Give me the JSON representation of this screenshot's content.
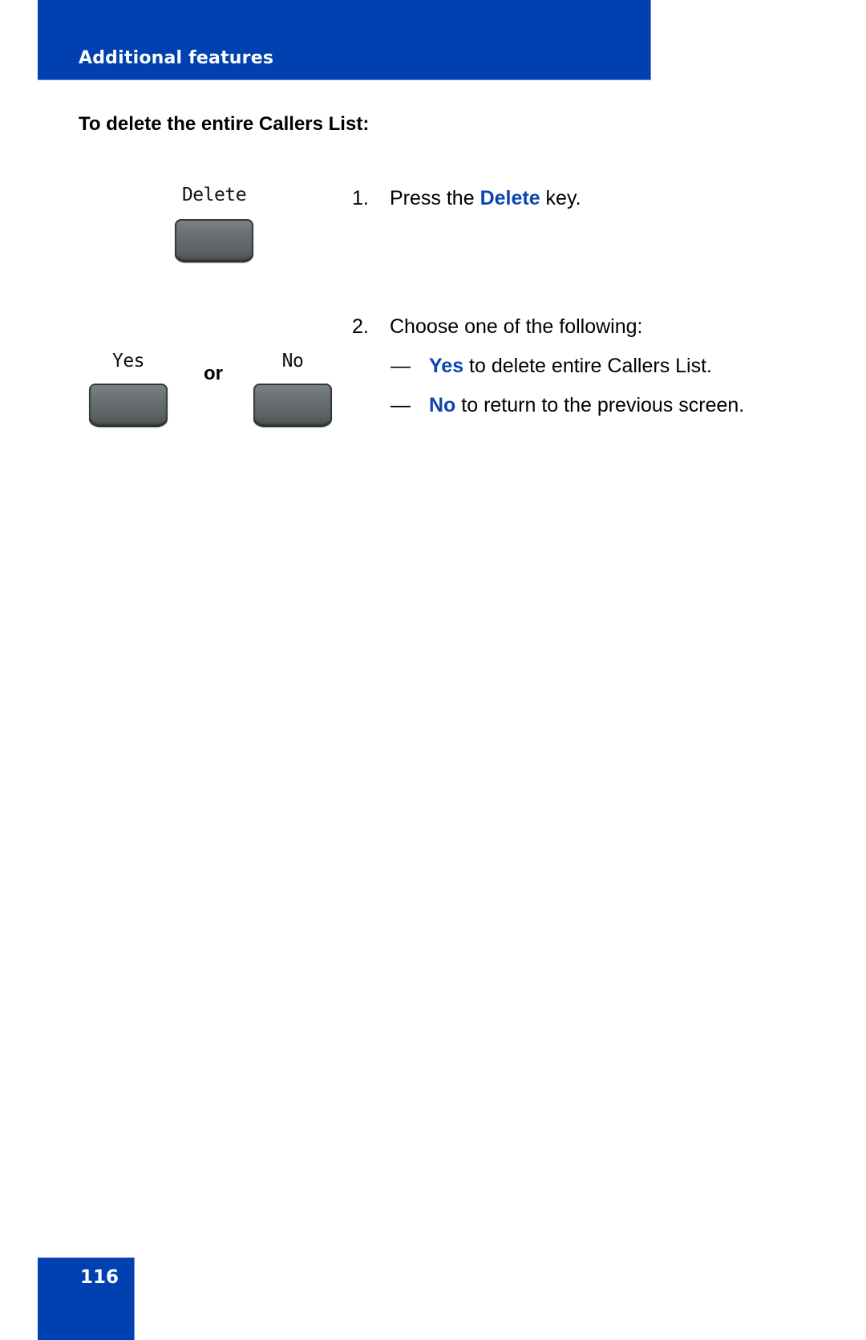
{
  "header": {
    "title": "Additional features",
    "color": "#0040b0"
  },
  "section": {
    "heading": "To delete the entire Callers List:"
  },
  "keys": {
    "delete": {
      "label": "Delete",
      "icon": "softkey-button"
    },
    "yes": {
      "label": "Yes",
      "icon": "softkey-button"
    },
    "no": {
      "label": "No",
      "icon": "softkey-button"
    },
    "separator": "or"
  },
  "steps": [
    {
      "number": "1.",
      "prefix": "Press the ",
      "highlight": "Delete",
      "suffix": " key."
    },
    {
      "number": "2.",
      "text": "Choose one of the following:",
      "options": [
        {
          "dash": "—",
          "highlight": "Yes",
          "text": " to delete entire Callers List."
        },
        {
          "dash": "—",
          "highlight": "No",
          "text": " to return to the previous screen."
        }
      ]
    }
  ],
  "highlight_color": "#0d45b0",
  "footer": {
    "page_number": "116"
  }
}
